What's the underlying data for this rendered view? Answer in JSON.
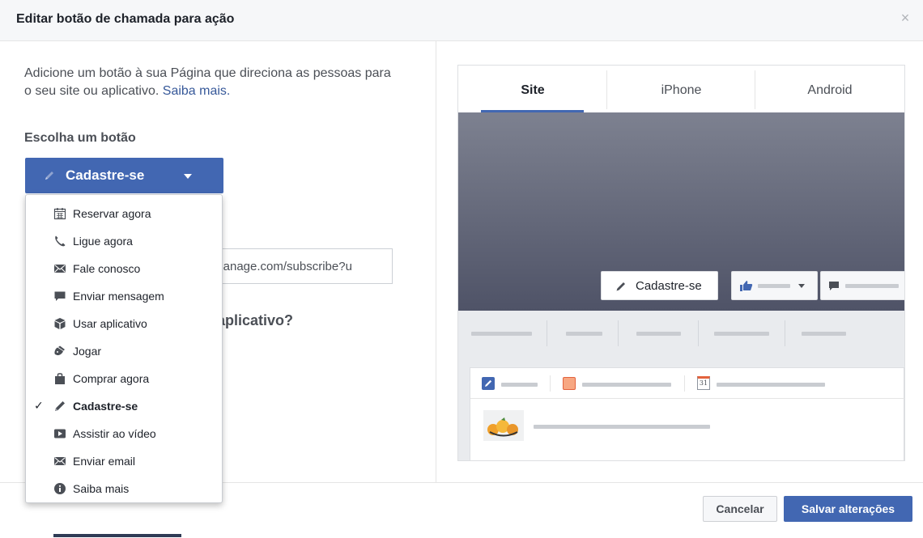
{
  "dialog": {
    "title": "Editar botão de chamada para ação",
    "close_glyph": "×"
  },
  "left": {
    "intro_text": "Adicione um botão à sua Página que direciona as pessoas para o seu site ou aplicativo.",
    "intro_link": "Saiba mais.",
    "choose_label": "Escolha um botão",
    "selected_button": "Cadastre-se",
    "url_value": "t-manage.com/subscribe?u",
    "question_fragment": "n aplicativo?"
  },
  "menu": {
    "items": [
      {
        "label": "Reservar agora",
        "icon": "calendar-icon"
      },
      {
        "label": "Ligue agora",
        "icon": "phone-icon"
      },
      {
        "label": "Fale conosco",
        "icon": "envelope-icon"
      },
      {
        "label": "Enviar mensagem",
        "icon": "message-icon"
      },
      {
        "label": "Usar aplicativo",
        "icon": "cube-icon"
      },
      {
        "label": "Jogar",
        "icon": "gamepad-icon"
      },
      {
        "label": "Comprar agora",
        "icon": "bag-icon"
      },
      {
        "label": "Cadastre-se",
        "icon": "pencil-icon",
        "selected": true
      },
      {
        "label": "Assistir ao vídeo",
        "icon": "play-icon"
      },
      {
        "label": "Enviar email",
        "icon": "envelope-icon"
      },
      {
        "label": "Saiba mais",
        "icon": "info-icon"
      }
    ],
    "check_glyph": "✓"
  },
  "preview": {
    "tabs": [
      "Site",
      "iPhone",
      "Android"
    ],
    "active_tab": "Site",
    "cta_label": "Cadastre-se",
    "calendar_day": "31"
  },
  "footer": {
    "cancel_label": "Cancelar",
    "save_label": "Salvar alterações"
  },
  "colors": {
    "accent": "#4267b2",
    "link": "#365899"
  }
}
